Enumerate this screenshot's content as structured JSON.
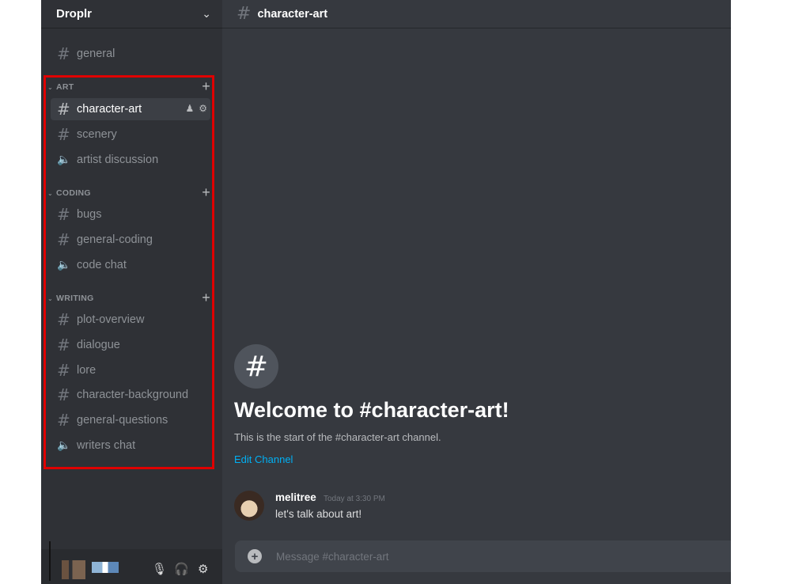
{
  "server": {
    "name": "Droplr",
    "chevron_icon": "chevron-down-icon"
  },
  "channels_top": [
    {
      "name": "general",
      "type": "text"
    }
  ],
  "categories": [
    {
      "name": "ART",
      "channels": [
        {
          "name": "character-art",
          "type": "text",
          "selected": true
        },
        {
          "name": "scenery",
          "type": "text"
        },
        {
          "name": "artist discussion",
          "type": "voice"
        }
      ]
    },
    {
      "name": "CODING",
      "channels": [
        {
          "name": "bugs",
          "type": "text"
        },
        {
          "name": "general-coding",
          "type": "text"
        },
        {
          "name": "code chat",
          "type": "voice"
        }
      ]
    },
    {
      "name": "WRITING",
      "channels": [
        {
          "name": "plot-overview",
          "type": "text"
        },
        {
          "name": "dialogue",
          "type": "text"
        },
        {
          "name": "lore",
          "type": "text"
        },
        {
          "name": "character-background",
          "type": "text"
        },
        {
          "name": "general-questions",
          "type": "text"
        },
        {
          "name": "writers chat",
          "type": "voice"
        }
      ]
    }
  ],
  "main": {
    "header_title": "character-art",
    "welcome_title": "Welcome to #character-art!",
    "welcome_sub": "This is the start of the #character-art channel.",
    "edit_channel": "Edit Channel",
    "message": {
      "author": "melitree",
      "time": "Today at 3:30 PM",
      "text": "let's talk about art!"
    },
    "composer_placeholder": "Message #character-art"
  },
  "colors": {
    "sidebar": "#2f3136",
    "main": "#36393f",
    "highlight": "#e00000",
    "link": "#00b0f4"
  }
}
